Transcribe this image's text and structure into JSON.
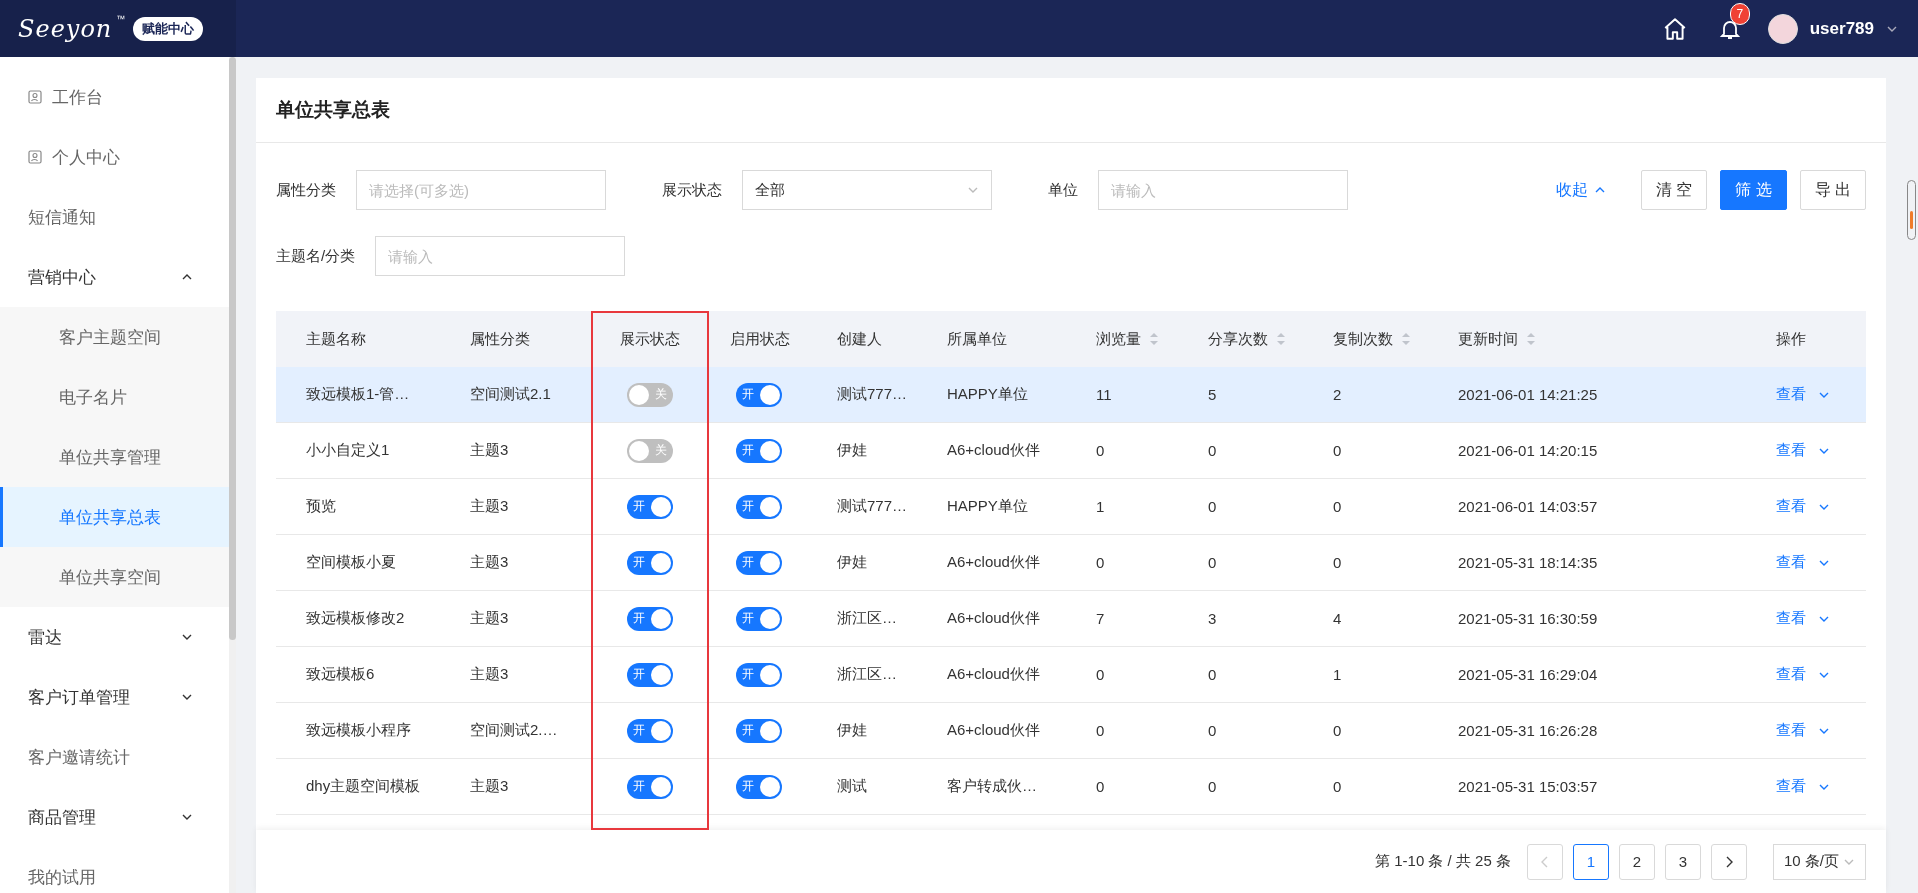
{
  "header": {
    "logo": "Seeyon",
    "trademark": "™",
    "badge": "赋能中心",
    "notifications": "7",
    "user": "user789"
  },
  "sidebar": {
    "items": [
      {
        "label": "工作台",
        "kind": "icon"
      },
      {
        "label": "个人中心",
        "kind": "icon"
      },
      {
        "label": "短信通知",
        "kind": "plain"
      },
      {
        "label": "营销中心",
        "kind": "group",
        "expanded": true,
        "children": [
          {
            "label": "客户主题空间",
            "selected": false
          },
          {
            "label": "电子名片",
            "selected": false
          },
          {
            "label": "单位共享管理",
            "selected": false
          },
          {
            "label": "单位共享总表",
            "selected": true
          },
          {
            "label": "单位共享空间",
            "selected": false
          }
        ]
      },
      {
        "label": "雷达",
        "kind": "group",
        "expanded": false
      },
      {
        "label": "客户订单管理",
        "kind": "group",
        "expanded": false
      },
      {
        "label": "客户邀请统计",
        "kind": "plain"
      },
      {
        "label": "商品管理",
        "kind": "group",
        "expanded": false
      },
      {
        "label": "我的试用",
        "kind": "plain"
      }
    ]
  },
  "page_title": "单位共享总表",
  "filters": [
    [
      {
        "label": "属性分类",
        "kind": "text",
        "placeholder": "请选择(可多选)"
      },
      {
        "label": "展示状态",
        "kind": "select",
        "value": "全部"
      },
      {
        "label": "单位",
        "kind": "text",
        "placeholder": "请输入"
      }
    ],
    [
      {
        "label": "主题名/分类",
        "kind": "text",
        "placeholder": "请输入"
      }
    ]
  ],
  "filter_actions": [
    {
      "label": "收起",
      "kind": "link"
    },
    {
      "label": "清 空",
      "kind": "default"
    },
    {
      "label": "筛 选",
      "kind": "primary"
    },
    {
      "label": "导 出",
      "kind": "default"
    }
  ],
  "table": {
    "columns": [
      {
        "label": "主题名称",
        "sortable": false,
        "highlighted": false
      },
      {
        "label": "属性分类",
        "sortable": false,
        "highlighted": false
      },
      {
        "label": "展示状态",
        "sortable": false,
        "highlighted": true
      },
      {
        "label": "启用状态",
        "sortable": false,
        "highlighted": false
      },
      {
        "label": "创建人",
        "sortable": false,
        "highlighted": false
      },
      {
        "label": "所属单位",
        "sortable": false,
        "highlighted": false
      },
      {
        "label": "浏览量",
        "sortable": true,
        "highlighted": false
      },
      {
        "label": "分享次数",
        "sortable": true,
        "highlighted": false
      },
      {
        "label": "复制次数",
        "sortable": true,
        "highlighted": false
      },
      {
        "label": "更新时间",
        "sortable": true,
        "highlighted": false
      },
      {
        "label": "操作",
        "sortable": false,
        "highlighted": false
      }
    ],
    "rows": [
      {
        "selected": true,
        "cells": [
          "致远模板1-管…",
          "空间测试2.1",
          {
            "kind": "toggle",
            "on": false,
            "text": "关"
          },
          {
            "kind": "toggle",
            "on": true,
            "text": "开"
          },
          "测试777…",
          "HAPPY单位",
          "11",
          "5",
          "2",
          "2021-06-01 14:21:25",
          {
            "kind": "action",
            "text": "查看"
          }
        ]
      },
      {
        "selected": false,
        "cells": [
          "小小自定义1",
          "主题3",
          {
            "kind": "toggle",
            "on": false,
            "text": "关"
          },
          {
            "kind": "toggle",
            "on": true,
            "text": "开"
          },
          "伊娃",
          "A6+cloud伙伴",
          "0",
          "0",
          "0",
          "2021-06-01 14:20:15",
          {
            "kind": "action",
            "text": "查看"
          }
        ]
      },
      {
        "selected": false,
        "cells": [
          "预览",
          "主题3",
          {
            "kind": "toggle",
            "on": true,
            "text": "开"
          },
          {
            "kind": "toggle",
            "on": true,
            "text": "开"
          },
          "测试777…",
          "HAPPY单位",
          "1",
          "0",
          "0",
          "2021-06-01 14:03:57",
          {
            "kind": "action",
            "text": "查看"
          }
        ]
      },
      {
        "selected": false,
        "cells": [
          "空间模板小夏",
          "主题3",
          {
            "kind": "toggle",
            "on": true,
            "text": "开"
          },
          {
            "kind": "toggle",
            "on": true,
            "text": "开"
          },
          "伊娃",
          "A6+cloud伙伴",
          "0",
          "0",
          "0",
          "2021-05-31 18:14:35",
          {
            "kind": "action",
            "text": "查看"
          }
        ]
      },
      {
        "selected": false,
        "cells": [
          "致远模板修改2",
          "主题3",
          {
            "kind": "toggle",
            "on": true,
            "text": "开"
          },
          {
            "kind": "toggle",
            "on": true,
            "text": "开"
          },
          "浙江区…",
          "A6+cloud伙伴",
          "7",
          "3",
          "4",
          "2021-05-31 16:30:59",
          {
            "kind": "action",
            "text": "查看"
          }
        ]
      },
      {
        "selected": false,
        "cells": [
          "致远模板6",
          "主题3",
          {
            "kind": "toggle",
            "on": true,
            "text": "开"
          },
          {
            "kind": "toggle",
            "on": true,
            "text": "开"
          },
          "浙江区…",
          "A6+cloud伙伴",
          "0",
          "0",
          "1",
          "2021-05-31 16:29:04",
          {
            "kind": "action",
            "text": "查看"
          }
        ]
      },
      {
        "selected": false,
        "cells": [
          "致远模板小程序",
          "空间测试2.…",
          {
            "kind": "toggle",
            "on": true,
            "text": "开"
          },
          {
            "kind": "toggle",
            "on": true,
            "text": "开"
          },
          "伊娃",
          "A6+cloud伙伴",
          "0",
          "0",
          "0",
          "2021-05-31 16:26:28",
          {
            "kind": "action",
            "text": "查看"
          }
        ]
      },
      {
        "selected": false,
        "cells": [
          "dhy主题空间模板",
          "主题3",
          {
            "kind": "toggle",
            "on": true,
            "text": "开"
          },
          {
            "kind": "toggle",
            "on": true,
            "text": "开"
          },
          "测试",
          "客户转成伙…",
          "0",
          "0",
          "0",
          "2021-05-31 15:03:57",
          {
            "kind": "action",
            "text": "查看"
          }
        ]
      }
    ]
  },
  "pagination": {
    "summary": "第 1-10 条 / 共 25 条",
    "prev_disabled": true,
    "pages": [
      {
        "label": "1",
        "selected": true
      },
      {
        "label": "2",
        "selected": false
      },
      {
        "label": "3",
        "selected": false
      }
    ],
    "page_size": "10 条/页"
  }
}
